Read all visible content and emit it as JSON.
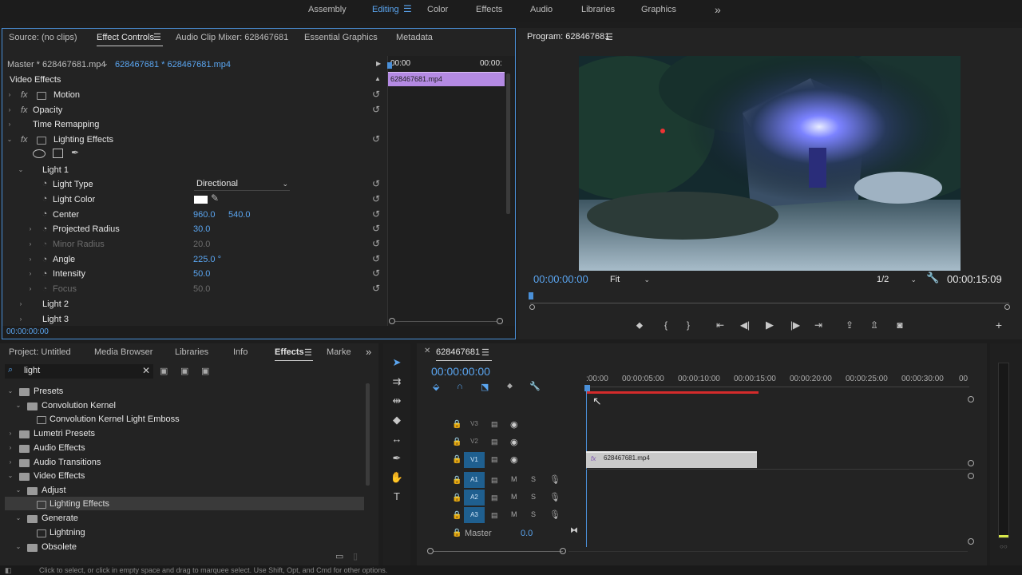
{
  "workspaces": [
    {
      "label": "Assembly",
      "active": false
    },
    {
      "label": "Editing",
      "active": true
    },
    {
      "label": "Color",
      "active": false
    },
    {
      "label": "Effects",
      "active": false
    },
    {
      "label": "Audio",
      "active": false
    },
    {
      "label": "Libraries",
      "active": false
    },
    {
      "label": "Graphics",
      "active": false
    }
  ],
  "more_workspaces": "»",
  "source_panel": {
    "tabs": [
      "Source: (no clips)",
      "Effect Controls",
      "Audio Clip Mixer: 628467681",
      "Essential Graphics",
      "Metadata"
    ],
    "master_label": "Master * 628467681.mp4",
    "clip_label": "628467681 * 628467681.mp4",
    "time_start": "00:00",
    "time_end": "00:00:",
    "clip_name": "628467681.mp4",
    "section": "Video Effects",
    "effects": [
      "Motion",
      "Opacity",
      "Time Remapping",
      "Lighting Effects"
    ],
    "fx": "fx",
    "light1": "Light 1",
    "params": {
      "light_type": {
        "label": "Light Type",
        "value": "Directional"
      },
      "light_color": {
        "label": "Light Color",
        "swatch": "#ffffff"
      },
      "center": {
        "label": "Center",
        "x": "960.0",
        "y": "540.0"
      },
      "projected_radius": {
        "label": "Projected Radius",
        "value": "30.0"
      },
      "minor_radius": {
        "label": "Minor Radius",
        "value": "20.0"
      },
      "angle": {
        "label": "Angle",
        "value": "225.0 °"
      },
      "intensity": {
        "label": "Intensity",
        "value": "50.0"
      },
      "focus": {
        "label": "Focus",
        "value": "50.0"
      }
    },
    "light2": "Light 2",
    "light3": "Light 3",
    "timecode": "00:00:00:00"
  },
  "program": {
    "title": "Program: 628467681",
    "timecode": "00:00:00:00",
    "fit": "Fit",
    "resolution": "1/2",
    "duration": "00:00:15:09"
  },
  "project_panel": {
    "tabs": [
      "Project: Untitled",
      "Media Browser",
      "Libraries",
      "Info",
      "Effects",
      "Marke"
    ],
    "search_value": "light",
    "tree": [
      {
        "label": "Presets",
        "level": 0
      },
      {
        "label": "Convolution Kernel",
        "level": 1
      },
      {
        "label": "Convolution Kernel Light Emboss",
        "level": 2
      },
      {
        "label": "Lumetri Presets",
        "level": 0
      },
      {
        "label": "Audio Effects",
        "level": 0
      },
      {
        "label": "Audio Transitions",
        "level": 0
      },
      {
        "label": "Video Effects",
        "level": 0
      },
      {
        "label": "Adjust",
        "level": 1
      },
      {
        "label": "Lighting Effects",
        "level": 2,
        "selected": true
      },
      {
        "label": "Generate",
        "level": 1
      },
      {
        "label": "Lightning",
        "level": 2
      },
      {
        "label": "Obsolete",
        "level": 1
      }
    ]
  },
  "timeline": {
    "sequence": "628467681",
    "timecode": "00:00:00:00",
    "ruler": [
      ":00:00",
      "00:00:05:00",
      "00:00:10:00",
      "00:00:15:00",
      "00:00:20:00",
      "00:00:25:00",
      "00:00:30:00",
      "00"
    ],
    "tracks_video": [
      "V3",
      "V2",
      "V1"
    ],
    "tracks_audio": [
      "A1",
      "A2",
      "A3"
    ],
    "mute": "M",
    "solo": "S",
    "master_label": "Master",
    "master_value": "0.0",
    "clip_name": "628467681.mp4"
  },
  "status_text": "Click to select, or click in empty space and drag to marquee select. Use Shift, Opt, and Cmd for other options.",
  "colors": {
    "accent": "#5aa5f0",
    "clip_purple": "#b48ae3",
    "render_bar": "#d42b2b",
    "track_active": "#1f5f8f"
  }
}
